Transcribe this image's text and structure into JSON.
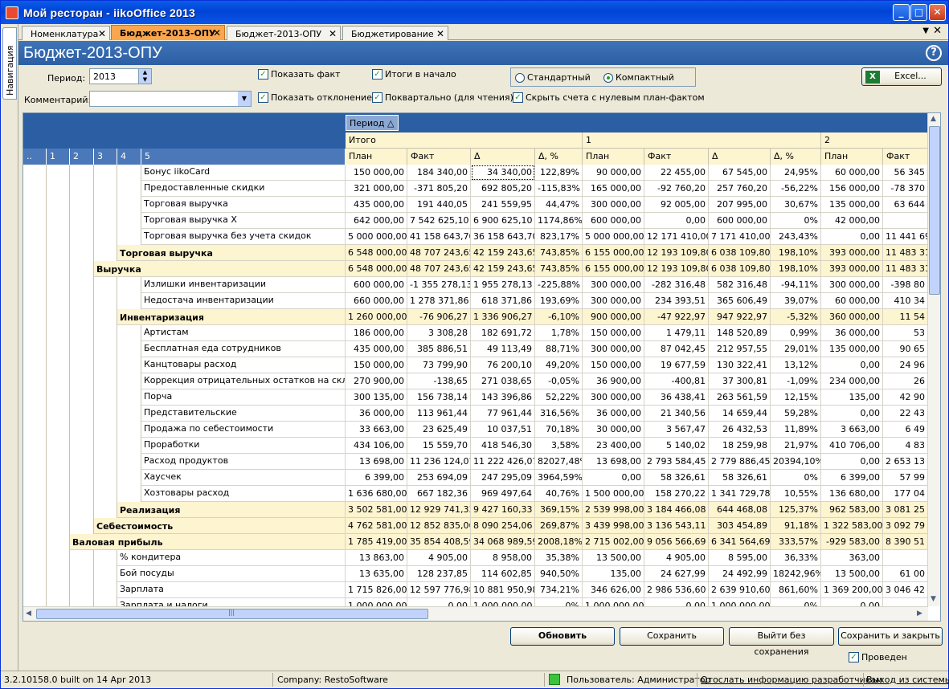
{
  "window": {
    "title": "Мой ресторан - iikoOffice 2013",
    "min": "_",
    "max": "□",
    "close": "✕"
  },
  "sidebar": {
    "nav_label": "Навигация"
  },
  "tabs": [
    {
      "label": "Номенклатура",
      "close": "✕"
    },
    {
      "label": "Бюджет-2013-ОПУ",
      "close": "✕"
    },
    {
      "label": "Бюджет-2013-ОПУ",
      "close": "✕"
    },
    {
      "label": "Бюджетирование",
      "close": "✕"
    }
  ],
  "tabs_controls": {
    "menu": "▼",
    "close_all": "✕"
  },
  "header": {
    "title": "Бюджет-2013-ОПУ",
    "help": "?"
  },
  "filters": {
    "period_label": "Период:",
    "period_value": "2013",
    "comment_label": "Комментарий:",
    "comment_value": "",
    "checks": [
      {
        "label": "Показать факт",
        "checked": true
      },
      {
        "label": "Итоги в начало",
        "checked": true
      },
      {
        "label": "Показать отклонение",
        "checked": true
      },
      {
        "label": "Поквартально (для чтения)",
        "checked": true
      },
      {
        "label": "Скрыть счета с нулевым план-фактом",
        "checked": true
      }
    ],
    "radio_standard": "Стандартный",
    "radio_compact": "Компактный",
    "radio_selected": "Компактный",
    "excel_label": "Excel...",
    "spin_up": "▲",
    "spin_down": "▼",
    "combo_arrow": "▼",
    "check_mark": "✓"
  },
  "grid": {
    "period_chip": "Период",
    "period_sort": "△",
    "levels": [
      "..",
      "1",
      "2",
      "3",
      "4",
      "5"
    ],
    "groups": [
      "Итого",
      "1",
      "2"
    ],
    "columns": [
      "План",
      "Факт",
      "Δ",
      "Δ, %",
      "План",
      "Факт",
      "Δ",
      "Δ, %",
      "План",
      "Факт"
    ],
    "rows": [
      {
        "level": 5,
        "name": "Бонус iikoCard",
        "values": [
          "150 000,00",
          "184 340,00",
          "34 340,00",
          "122,89%",
          "90 000,00",
          "22 455,00",
          "67 545,00",
          "24,95%",
          "60 000,00",
          "56 345"
        ]
      },
      {
        "level": 5,
        "name": "Предоставленные скидки",
        "values": [
          "321 000,00",
          "-371 805,20",
          "692 805,20",
          "-115,83%",
          "165 000,00",
          "-92 760,20",
          "257 760,20",
          "-56,22%",
          "156 000,00",
          "-78 370"
        ]
      },
      {
        "level": 5,
        "name": "Торговая выручка",
        "values": [
          "435 000,00",
          "191 440,05",
          "241 559,95",
          "44,47%",
          "300 000,00",
          "92 005,00",
          "207 995,00",
          "30,67%",
          "135 000,00",
          "63 644"
        ]
      },
      {
        "level": 5,
        "name": "Торговая выручка X",
        "values": [
          "642 000,00",
          "7 542 625,10",
          "6 900 625,10",
          "1174,86%",
          "600 000,00",
          "0,00",
          "600 000,00",
          "0%",
          "42 000,00",
          ""
        ]
      },
      {
        "level": 5,
        "name": "Торговая выручка без учета скидок",
        "values": [
          "5 000 000,00",
          "41 158 643,70",
          "36 158 643,70",
          "823,17%",
          "5 000 000,00",
          "12 171 410,00",
          "7 171 410,00",
          "243,43%",
          "0,00",
          "11 441 693"
        ]
      },
      {
        "level": 4,
        "name": "Торговая выручка",
        "values": [
          "6 548 000,00",
          "48 707 243,65",
          "42 159 243,65",
          "743,85%",
          "6 155 000,00",
          "12 193 109,80",
          "6 038 109,80",
          "198,10%",
          "393 000,00",
          "11 483 31"
        ]
      },
      {
        "level": 3,
        "name": "Выручка",
        "values": [
          "6 548 000,00",
          "48 707 243,65",
          "42 159 243,65",
          "743,85%",
          "6 155 000,00",
          "12 193 109,80",
          "6 038 109,80",
          "198,10%",
          "393 000,00",
          "11 483 31"
        ]
      },
      {
        "level": 5,
        "name": "Излишки инвентаризации",
        "values": [
          "600 000,00",
          "-1 355 278,13",
          "1 955 278,13",
          "-225,88%",
          "300 000,00",
          "-282 316,48",
          "582 316,48",
          "-94,11%",
          "300 000,00",
          "-398 80"
        ]
      },
      {
        "level": 5,
        "name": "Недостача инвентаризации",
        "values": [
          "660 000,00",
          "1 278 371,86",
          "618 371,86",
          "193,69%",
          "300 000,00",
          "234 393,51",
          "365 606,49",
          "39,07%",
          "60 000,00",
          "410 34"
        ]
      },
      {
        "level": 4,
        "name": "Инвентаризация",
        "values": [
          "1 260 000,00",
          "-76 906,27",
          "1 336 906,27",
          "-6,10%",
          "900 000,00",
          "-47 922,97",
          "947 922,97",
          "-5,32%",
          "360 000,00",
          "11 54"
        ]
      },
      {
        "level": 5,
        "name": "Артистам",
        "values": [
          "186 000,00",
          "3 308,28",
          "182 691,72",
          "1,78%",
          "150 000,00",
          "1 479,11",
          "148 520,89",
          "0,99%",
          "36 000,00",
          "53"
        ]
      },
      {
        "level": 5,
        "name": "Бесплатная еда сотрудников",
        "values": [
          "435 000,00",
          "385 886,51",
          "49 113,49",
          "88,71%",
          "300 000,00",
          "87 042,45",
          "212 957,55",
          "29,01%",
          "135 000,00",
          "90 65"
        ]
      },
      {
        "level": 5,
        "name": "Канцтовары расход",
        "values": [
          "150 000,00",
          "73 799,90",
          "76 200,10",
          "49,20%",
          "150 000,00",
          "19 677,59",
          "130 322,41",
          "13,12%",
          "0,00",
          "24 96"
        ]
      },
      {
        "level": 5,
        "name": "Коррекция отрицательных остатков на складе",
        "values": [
          "270 900,00",
          "-138,65",
          "271 038,65",
          "-0,05%",
          "36 900,00",
          "-400,81",
          "37 300,81",
          "-1,09%",
          "234 000,00",
          "26"
        ]
      },
      {
        "level": 5,
        "name": "Порча",
        "values": [
          "300 135,00",
          "156 738,14",
          "143 396,86",
          "52,22%",
          "300 000,00",
          "36 438,41",
          "263 561,59",
          "12,15%",
          "135,00",
          "42 90"
        ]
      },
      {
        "level": 5,
        "name": "Представительские",
        "values": [
          "36 000,00",
          "113 961,44",
          "77 961,44",
          "316,56%",
          "36 000,00",
          "21 340,56",
          "14 659,44",
          "59,28%",
          "0,00",
          "22 43"
        ]
      },
      {
        "level": 5,
        "name": "Продажа по себестоимости",
        "values": [
          "33 663,00",
          "23 625,49",
          "10 037,51",
          "70,18%",
          "30 000,00",
          "3 567,47",
          "26 432,53",
          "11,89%",
          "3 663,00",
          "6 49"
        ]
      },
      {
        "level": 5,
        "name": "Проработки",
        "values": [
          "434 106,00",
          "15 559,70",
          "418 546,30",
          "3,58%",
          "23 400,00",
          "5 140,02",
          "18 259,98",
          "21,97%",
          "410 706,00",
          "4 83"
        ]
      },
      {
        "level": 5,
        "name": "Расход продуктов",
        "values": [
          "13 698,00",
          "11 236 124,07",
          "11 222 426,07",
          "82027,48%",
          "13 698,00",
          "2 793 584,45",
          "2 779 886,45",
          "20394,10%",
          "0,00",
          "2 653 13"
        ]
      },
      {
        "level": 5,
        "name": "Хаусчек",
        "values": [
          "6 399,00",
          "253 694,09",
          "247 295,09",
          "3964,59%",
          "0,00",
          "58 326,61",
          "58 326,61",
          "0%",
          "6 399,00",
          "57 99"
        ]
      },
      {
        "level": 5,
        "name": "Хозтовары расход",
        "values": [
          "1 636 680,00",
          "667 182,36",
          "969 497,64",
          "40,76%",
          "1 500 000,00",
          "158 270,22",
          "1 341 729,78",
          "10,55%",
          "136 680,00",
          "177 04"
        ]
      },
      {
        "level": 4,
        "name": "Реализация",
        "values": [
          "3 502 581,00",
          "12 929 741,33",
          "9 427 160,33",
          "369,15%",
          "2 539 998,00",
          "3 184 466,08",
          "644 468,08",
          "125,37%",
          "962 583,00",
          "3 081 25"
        ]
      },
      {
        "level": 3,
        "name": "Себестоимость",
        "values": [
          "4 762 581,00",
          "12 852 835,06",
          "8 090 254,06",
          "269,87%",
          "3 439 998,00",
          "3 136 543,11",
          "303 454,89",
          "91,18%",
          "1 322 583,00",
          "3 092 79"
        ]
      },
      {
        "level": 2,
        "name": "Валовая прибыль",
        "values": [
          "1 785 419,00",
          "35 854 408,59",
          "34 068 989,59",
          "2008,18%",
          "2 715 002,00",
          "9 056 566,69",
          "6 341 564,69",
          "333,57%",
          "-929 583,00",
          "8 390 51"
        ]
      },
      {
        "level": 4,
        "name": "% кондитера",
        "leaf": true,
        "values": [
          "13 863,00",
          "4 905,00",
          "8 958,00",
          "35,38%",
          "13 500,00",
          "4 905,00",
          "8 595,00",
          "36,33%",
          "363,00",
          ""
        ]
      },
      {
        "level": 4,
        "name": "Бой посуды",
        "leaf": true,
        "values": [
          "13 635,00",
          "128 237,85",
          "114 602,85",
          "940,50%",
          "135,00",
          "24 627,99",
          "24 492,99",
          "18242,96%",
          "13 500,00",
          "61 00"
        ]
      },
      {
        "level": 4,
        "name": "Зарплата",
        "leaf": true,
        "values": [
          "1 715 826,00",
          "12 597 776,98",
          "10 881 950,98",
          "734,21%",
          "346 626,00",
          "2 986 536,60",
          "2 639 910,60",
          "861,60%",
          "1 369 200,00",
          "3 046 42"
        ]
      },
      {
        "level": 4,
        "name": "Зарплата и налоги",
        "leaf": true,
        "values": [
          "1 000 000,00",
          "0,00",
          "1 000 000,00",
          "0%",
          "1 000 000,00",
          "0,00",
          "1 000 000,00",
          "0%",
          "0,00",
          ""
        ]
      }
    ]
  },
  "scroll": {
    "up": "▲",
    "down": "▼",
    "left": "◀",
    "right": "▶",
    "grip": "|||"
  },
  "actions": {
    "refresh": "Обновить",
    "save": "Сохранить",
    "exit_no_save": "Выйти без сохранения",
    "save_close": "Сохранить и закрыть",
    "posted_label": "Проведен",
    "posted_checked": true
  },
  "status": {
    "build": "3.2.10158.0 built on 14 Apr 2013",
    "company": "Company: RestoSoftware",
    "user": "Пользователь: Администратор",
    "send_info": "Отослать информацию разработчикам",
    "logout": "Выход из системы"
  },
  "colors": {
    "header_blue": "#2c5ea3",
    "subtotal_bg": "#fdf4d0",
    "active_tab": "#f9a64f",
    "status_green": "#3cc33c"
  }
}
